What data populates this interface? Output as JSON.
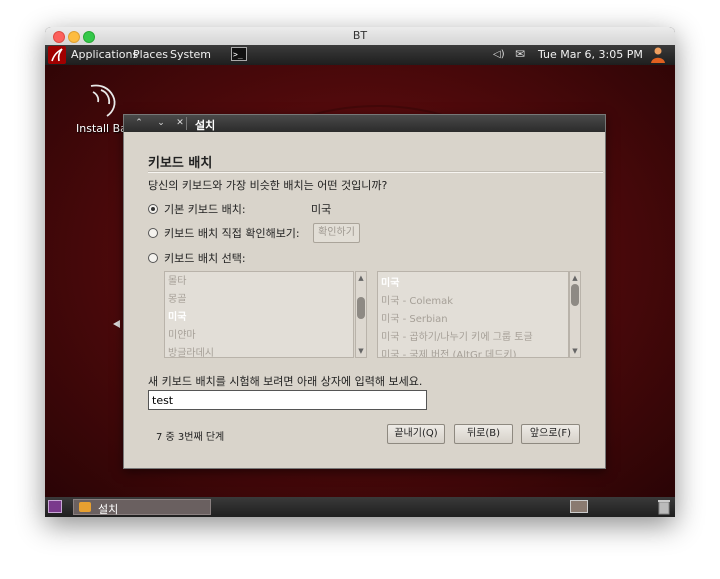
{
  "window": {
    "title": "BT"
  },
  "top_panel": {
    "menus": [
      "Applications",
      "Places",
      "System"
    ],
    "clock": "Tue Mar  6,  3:05 PM"
  },
  "desktop": {
    "icon_label": "Install Bac"
  },
  "taskbar": {
    "task_label": "설치"
  },
  "dialog": {
    "title": "설치",
    "heading": "키보드 배치",
    "question": "당신의 키보드와 가장 비슷한 배치는 어떤 것입니까?",
    "options": [
      {
        "label": "기본 키보드 배치:",
        "checked": true
      },
      {
        "label": "키보드 배치 직접 확인해보기:",
        "checked": false
      },
      {
        "label": "키보드 배치 선택:",
        "checked": false
      }
    ],
    "default_layout_value": "미국",
    "confirm_button": "확인하기",
    "country_list": [
      {
        "label": "몰타",
        "selected": false
      },
      {
        "label": "몽골",
        "selected": false
      },
      {
        "label": "미국",
        "selected": true
      },
      {
        "label": "미얀마",
        "selected": false
      },
      {
        "label": "방글라데시",
        "selected": false
      }
    ],
    "variant_list": [
      {
        "label": "미국",
        "selected": true
      },
      {
        "label": "미국 - Colemak",
        "selected": false
      },
      {
        "label": "미국 - Serbian",
        "selected": false
      },
      {
        "label": "미국 - 곱하기/나누기 키에 그룹 토글",
        "selected": false
      },
      {
        "label": "미국 - 국제 버전 (AltGr 데드키)",
        "selected": false
      }
    ],
    "test_prompt": "새 키보드 배치를 시험해 보려면 아래 상자에 입력해 보세요.",
    "test_input_value": "test",
    "step_text": "7 중 3번째 단계",
    "buttons": {
      "quit": "끝내기(Q)",
      "back": "뒤로(B)",
      "forward": "앞으로(F)"
    }
  }
}
